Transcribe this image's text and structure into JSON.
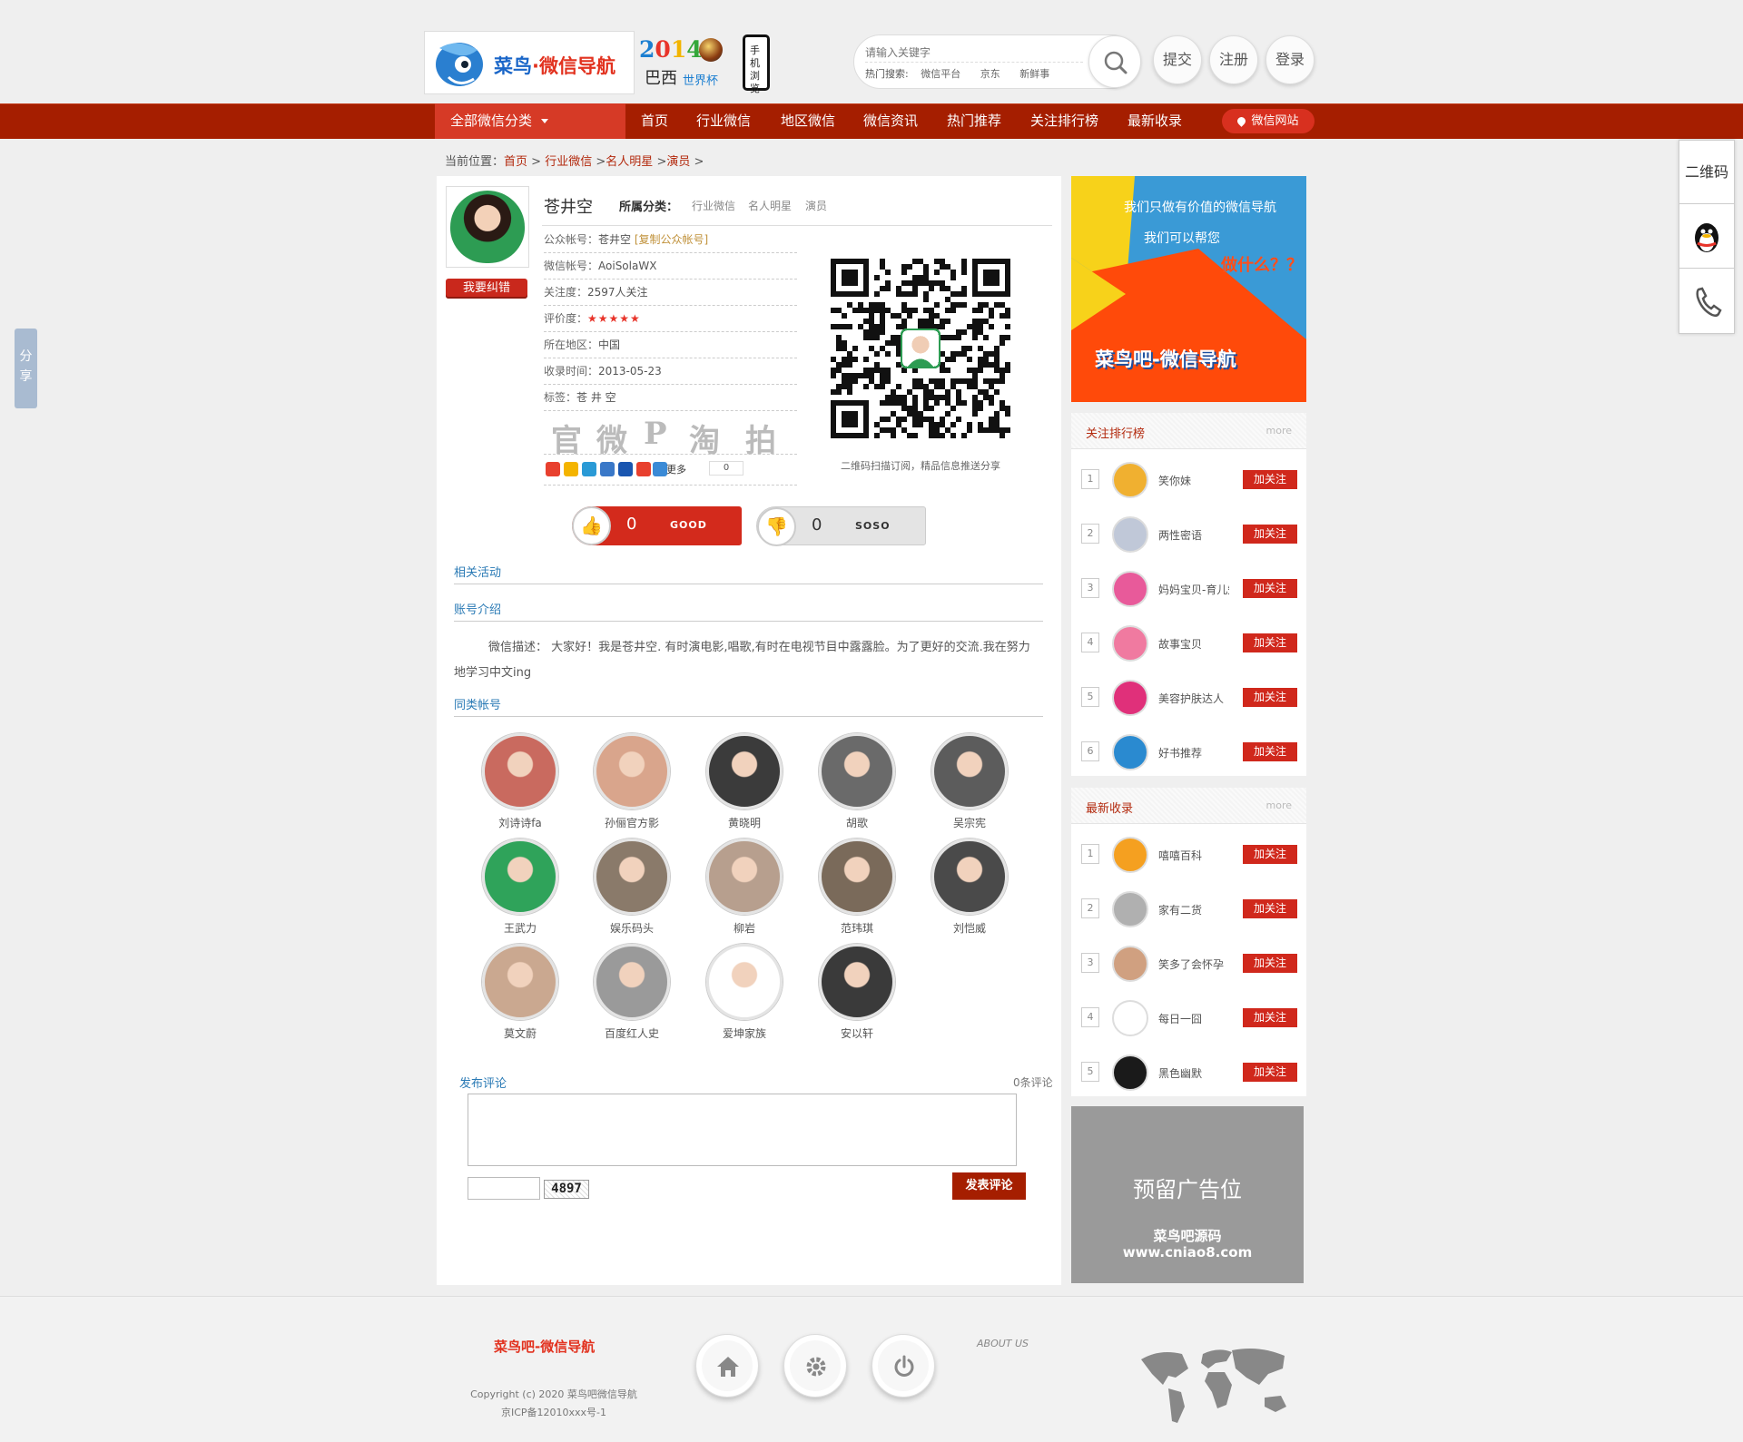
{
  "header": {
    "logo_text_a": "菜鸟",
    "logo_text_b": "·微信导航",
    "worldcup_year_digits": [
      "2",
      "0",
      "1",
      "4"
    ],
    "worldcup_country": "巴西",
    "worldcup_label": "世界杯",
    "phone_label": "手机浏览",
    "search_placeholder": "请输入关键字",
    "hot_label": "热门搜索:",
    "hot_links": [
      "微信平台",
      "京东",
      "新鲜事"
    ],
    "submit_label": "提交",
    "register_label": "注册",
    "login_label": "登录"
  },
  "nav": {
    "all_categories": "全部微信分类",
    "items": [
      "首页",
      "行业微信",
      "地区微信",
      "微信资讯",
      "热门推荐",
      "关注排行榜",
      "最新收录"
    ],
    "wx_site": "微信网站",
    "accent": "#a51e00"
  },
  "breadcrumb": {
    "prefix": "当前位置：",
    "items": [
      "首页",
      "行业微信",
      "名人明星",
      "演员"
    ],
    "sep": ">"
  },
  "account": {
    "name": "苍井空",
    "category_label": "所属分类：",
    "categories": [
      "行业微信",
      "名人明星",
      "演员"
    ],
    "correction_button": "我要纠错",
    "info": [
      {
        "key": "公众帐号：",
        "value": "苍井空",
        "extra": "[复制公众帐号]"
      },
      {
        "key": "微信帐号：",
        "value": "AoiSolaWX"
      },
      {
        "key": "关注度：",
        "value": "2597人关注"
      },
      {
        "key": "评价度：",
        "value": "★★★★★"
      },
      {
        "key": "所在地区：",
        "value": "中国"
      },
      {
        "key": "收录时间：",
        "value": "2013-05-23"
      },
      {
        "key": "标签：",
        "value": "苍 井 空"
      }
    ],
    "share_glyphs": [
      "官",
      "微",
      "P",
      "淘",
      "拍"
    ],
    "more_label": "更多",
    "share_count": "0",
    "qr_caption": "二维码扫描订阅，精品信息推送分享",
    "good_count": "0",
    "good_label": "GOOD",
    "soso_count": "0",
    "soso_label": "SOSO"
  },
  "sections": {
    "related": "相关活动",
    "intro": "账号介绍",
    "intro_text": "微信描述： 大家好！我是苍井空. 有时演电影,唱歌,有时在电视节目中露露脸。为了更好的交流.我在努力地学习中文ing",
    "similar": "同类帐号"
  },
  "similar": [
    {
      "name": "刘诗诗fa",
      "color": "#c96a5f"
    },
    {
      "name": "孙俪官方影",
      "color": "#d9a58c"
    },
    {
      "name": "黄晓明",
      "color": "#3b3b3b"
    },
    {
      "name": "胡歌",
      "color": "#6a6a6a"
    },
    {
      "name": "吴宗宪",
      "color": "#5c5c5c"
    },
    {
      "name": "王武力",
      "color": "#2fa35a"
    },
    {
      "name": "娱乐码头",
      "color": "#8a7a6a"
    },
    {
      "name": "柳岩",
      "color": "#b79f8e"
    },
    {
      "name": "范玮琪",
      "color": "#7a6a5a"
    },
    {
      "name": "刘恺威",
      "color": "#4a4a4a"
    },
    {
      "name": "莫文蔚",
      "color": "#caa890"
    },
    {
      "name": "百度红人史",
      "color": "#9a9a9a"
    },
    {
      "name": "爱坤家族",
      "color": "#ffffff"
    },
    {
      "name": "安以轩",
      "color": "#3a3a3a"
    }
  ],
  "comment": {
    "title": "发布评论",
    "count": "0条评论",
    "captcha": "4897",
    "submit": "发表评论"
  },
  "banner": {
    "line1": "我们只做有价值的微信导航",
    "line2": "我们可以帮您",
    "line3": "做什么？？",
    "line4": "菜鸟吧-微信导航"
  },
  "ranking": {
    "title": "关注排行榜",
    "more": "more",
    "follow_label": "加关注",
    "items": [
      {
        "rank": "1",
        "name": "笑你妹",
        "color": "#f0b030"
      },
      {
        "rank": "2",
        "name": "两性密语",
        "color": "#c0c8d8"
      },
      {
        "rank": "3",
        "name": "妈妈宝贝-育儿知识",
        "color": "#e85a9a"
      },
      {
        "rank": "4",
        "name": "故事宝贝",
        "color": "#f07aa0"
      },
      {
        "rank": "5",
        "name": "美容护肤达人",
        "color": "#e0307a"
      },
      {
        "rank": "6",
        "name": "好书推荐",
        "color": "#2a8ad0"
      }
    ]
  },
  "latest": {
    "title": "最新收录",
    "more": "more",
    "follow_label": "加关注",
    "items": [
      {
        "rank": "1",
        "name": "嘻嘻百科",
        "color": "#f5a020"
      },
      {
        "rank": "2",
        "name": "家有二货",
        "color": "#b0b0b0"
      },
      {
        "rank": "3",
        "name": "笑多了会怀孕",
        "color": "#d0a080"
      },
      {
        "rank": "4",
        "name": "每日一囧",
        "color": "#ffffff"
      },
      {
        "rank": "5",
        "name": "黑色幽默",
        "color": "#1a1a1a"
      }
    ]
  },
  "ad": {
    "line1": "预留广告位",
    "line2": "菜鸟吧源码",
    "line3": "www.cniao8.com"
  },
  "sidebar": {
    "qr_label": "二维码",
    "share_label": "分享"
  },
  "footer": {
    "logo": "菜鸟吧-微信导航",
    "copyright": "Copyright (c) 2020 菜鸟吧微信导航",
    "icp": "京ICP备12010xxx号-1",
    "about": "ABOUT US"
  }
}
